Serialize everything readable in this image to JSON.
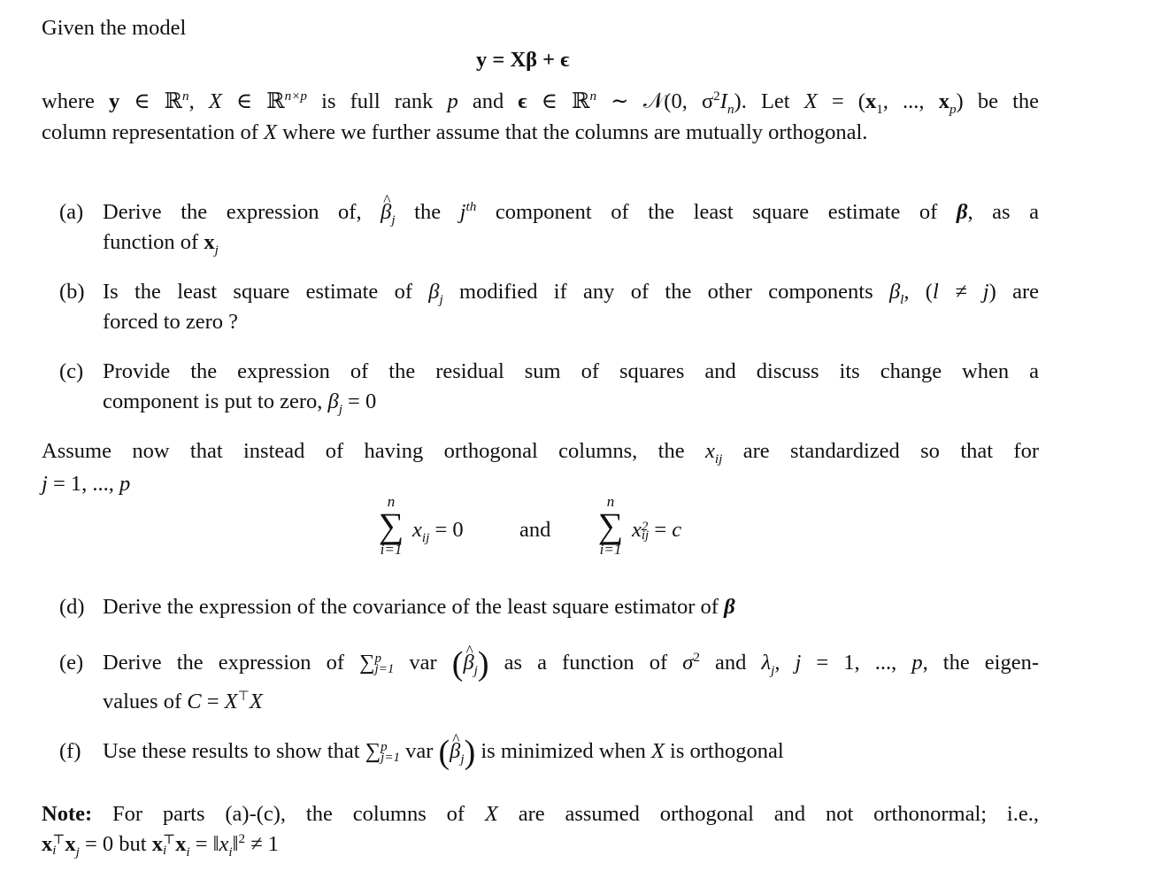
{
  "intro": {
    "heading": "Given the model",
    "model_equation": "y = Xβ + ϵ",
    "assumptions_line1": {
      "t1": "where ",
      "y": "y",
      "t2": " ∈ ℝ",
      "n": "n",
      "t3": ", ",
      "X": "X",
      "t4": " ∈ ℝ",
      "nxp": "n×p",
      "t5": " is full rank ",
      "p": "p",
      "t6": " and ",
      "eps": "ϵ",
      "t7": " ∈ ℝ",
      "n2": "n",
      "t8": " ∼ 𝒩(0, σ",
      "sq": "2",
      "t9": "I",
      "nsub": "n",
      "t10": ").  Let ",
      "X2": "X",
      "t11": " = (",
      "x1": "x",
      "one": "1",
      "t12": ", ..., ",
      "xp": "x",
      "psub": "p",
      "t13": ") be the"
    },
    "assumptions_line2": {
      "t1": "column representation of ",
      "X": "X",
      "t2": " where we further assume that the columns are mutually orthogonal."
    }
  },
  "questions_part1": [
    {
      "label": "(a)",
      "line1": {
        "t1": "Derive the expression of, ",
        "beta": "β",
        "jsub": "j",
        "t2": " the ",
        "j": "j",
        "th": "th",
        "t3": " component of the least square estimate of ",
        "bbeta": "β",
        "t4": ", as a"
      },
      "line2": {
        "t1": "function of ",
        "x": "x",
        "jsub": "j"
      }
    },
    {
      "label": "(b)",
      "line1": {
        "t1": "Is the least square estimate of ",
        "beta": "β",
        "jsub": "j",
        "t2": " modified if any of the other components ",
        "beta2": "β",
        "lsub": "l",
        "t3": ", (",
        "cond": "l ≠ j",
        "t4": ") are"
      },
      "line2": {
        "t1": "forced to zero ?"
      }
    },
    {
      "label": "(c)",
      "line1": {
        "t1": "Provide the expression of the residual sum of squares and discuss its change when a"
      },
      "line2": {
        "t1": "component is put to zero, ",
        "beta": "β",
        "jsub": "j",
        "t2": " = 0"
      }
    }
  ],
  "standardization": {
    "line1": {
      "t1": "Assume now that instead of having orthogonal columns, the ",
      "x": "x",
      "ijsub": "ij",
      "t2": " are standardized so that for"
    },
    "line2": {
      "j": "j",
      "t1": " = 1, ..., ",
      "p": "p"
    },
    "equation": {
      "sum1_upper": "n",
      "sum1_lower": "i=1",
      "sum1_body_x": "x",
      "sum1_body_sub": "ij",
      "sum1_rhs": " = 0",
      "connector": "and",
      "sum2_upper": "n",
      "sum2_lower": "i=1",
      "sum2_body_x": "x",
      "sum2_body_sup": "2",
      "sum2_body_sub": "ij",
      "sum2_rhs": " = ",
      "sum2_c": "c"
    }
  },
  "questions_part2": [
    {
      "label": "(d)",
      "line1": {
        "t1": "Derive the expression of the covariance of the least square estimator of ",
        "bbeta": "β"
      }
    },
    {
      "label": "(e)",
      "line1": {
        "t1": "Derive the expression of ",
        "sum": "∑",
        "sum_sup": "p",
        "sum_sub": "j=1",
        "var": " var ",
        "lp": "(",
        "beta": "β",
        "jsub": "j",
        "rp": ")",
        "t2": " as a function of ",
        "sigma": "σ",
        "sq": "2",
        "t3": " and ",
        "lambda": "λ",
        "jsub2": "j",
        "t4": ", ",
        "j": "j",
        "t5": " = 1, ..., ",
        "p": "p",
        "t6": ", the eigen-"
      },
      "line2": {
        "t1": "values of ",
        "C": "C",
        "t2": " = ",
        "X": "X",
        "T": "⊤",
        "X2": "X"
      }
    },
    {
      "label": "(f)",
      "line1": {
        "t1": "Use these results to show that ",
        "sum": "∑",
        "sum_sup": "p",
        "sum_sub": "j=1",
        "var": " var ",
        "lp": "(",
        "beta": "β",
        "jsub": "j",
        "rp": ")",
        "t2": " is minimized when ",
        "X": "X",
        "t3": " is orthogonal"
      }
    }
  ],
  "note": {
    "label": "Note:",
    "line1": {
      "t1": " For parts (a)-(c), the columns of ",
      "X": "X",
      "t2": " are assumed orthogonal and not orthonormal; i.e.,"
    },
    "line2": {
      "x1": "x",
      "isub": "i",
      "T": "⊤",
      "x2": "x",
      "jsub": "j",
      "t1": " = 0 but ",
      "x3": "x",
      "isub2": "i",
      "T2": "⊤",
      "x4": "x",
      "isub3": "i",
      "t2": " = ‖",
      "xi": "x",
      "isub4": "i",
      "t3": "‖",
      "sq": "2",
      "t4": " ≠ 1"
    }
  }
}
